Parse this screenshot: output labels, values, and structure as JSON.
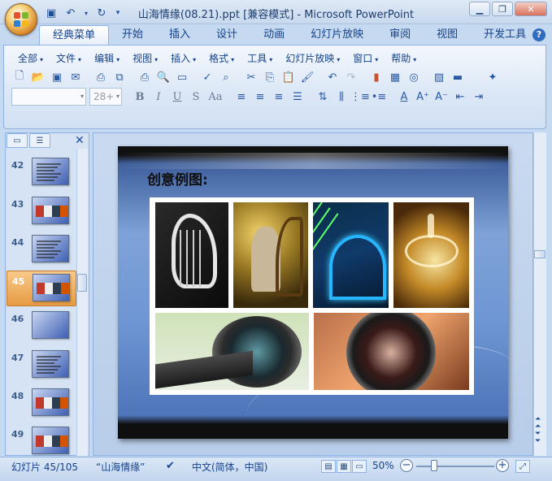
{
  "window": {
    "title": "山海情缘(08.21).ppt [兼容模式] - Microsoft PowerPoint",
    "controls": [
      "minimize",
      "restore",
      "close"
    ]
  },
  "quick_access": [
    "save-icon",
    "undo-icon",
    "redo-icon",
    "customize-icon"
  ],
  "ribbon_tabs": [
    {
      "label": "经典菜单",
      "active": true
    },
    {
      "label": "开始"
    },
    {
      "label": "插入"
    },
    {
      "label": "设计"
    },
    {
      "label": "动画"
    },
    {
      "label": "幻灯片放映"
    },
    {
      "label": "审阅"
    },
    {
      "label": "视图"
    },
    {
      "label": "开发工具"
    }
  ],
  "menus": [
    "全部",
    "文件",
    "编辑",
    "视图",
    "插入",
    "格式",
    "工具",
    "幻灯片放映",
    "窗口",
    "帮助"
  ],
  "format_bar": {
    "font_name": "",
    "font_size": "28+",
    "bold": "B",
    "italic": "I",
    "underline": "U",
    "strike": "S",
    "case": "Aa"
  },
  "slides_panel": {
    "thumbnails": [
      {
        "number": "42",
        "kind": "text"
      },
      {
        "number": "43",
        "kind": "image"
      },
      {
        "number": "44",
        "kind": "text"
      },
      {
        "number": "45",
        "kind": "image",
        "selected": true
      },
      {
        "number": "46",
        "kind": "blank"
      },
      {
        "number": "47",
        "kind": "text"
      },
      {
        "number": "48",
        "kind": "image"
      },
      {
        "number": "49",
        "kind": "image"
      }
    ]
  },
  "slide": {
    "title": "创意例图:",
    "images": [
      "white-harp-sculpture",
      "woman-playing-harp",
      "laser-harp",
      "golden-water-splash",
      "camera-lens-side",
      "camera-lens-front"
    ]
  },
  "status": {
    "slide_position": "幻灯片 45/105",
    "theme": "“山海情缘”",
    "language": "中文(简体，中国)",
    "zoom": "50%"
  },
  "colors": {
    "ribbon_text": "#15428b",
    "selected_thumb": "#f4b25c",
    "slide_bg": "#6f96d4"
  }
}
